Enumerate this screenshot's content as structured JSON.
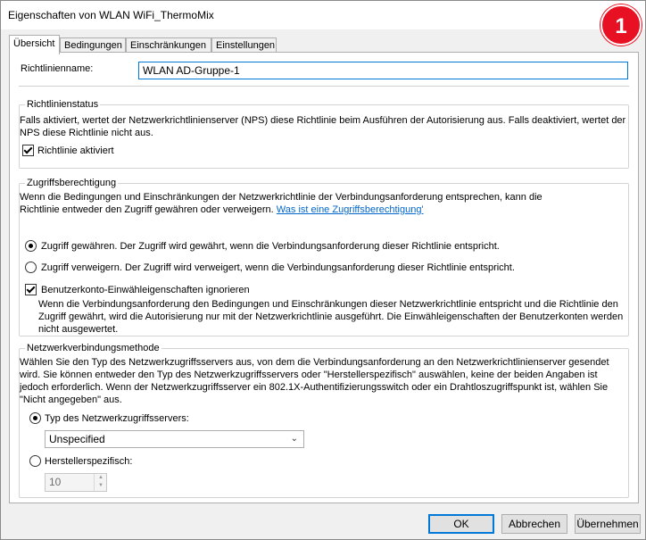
{
  "window": {
    "title": "Eigenschaften von WLAN WiFi_ThermoMix",
    "step_badge": "1"
  },
  "tabs": [
    {
      "label": "Übersicht",
      "active": true
    },
    {
      "label": "Bedingungen",
      "active": false
    },
    {
      "label": "Einschränkungen",
      "active": false
    },
    {
      "label": "Einstellungen",
      "active": false
    }
  ],
  "policy_name": {
    "label": "Richtlinienname:",
    "value": "WLAN AD-Gruppe-1"
  },
  "policy_status": {
    "title": "Richtlinienstatus",
    "description_1": "Falls aktiviert, wertet der Netzwerkrichtlinienserver (NPS) diese Richtlinie beim Ausführen der Autorisierung aus. Falls deaktiviert, wertet der",
    "description_2": "NPS diese Richtlinie nicht aus.",
    "enabled_label": "Richtlinie aktiviert",
    "enabled": true
  },
  "access_permission": {
    "title": "Zugriffsberechtigung",
    "description_1": "Wenn die Bedingungen und Einschränkungen der Netzwerkrichtlinie der Verbindungsanforderung entsprechen, kann die",
    "description_2": "Richtlinie entweder den Zugriff gewähren oder verweigern.",
    "help_link": "Was ist eine Zugriffsberechtigung'",
    "grant_label": "Zugriff gewähren. Der Zugriff wird gewährt, wenn die Verbindungsanforderung dieser Richtlinie entspricht.",
    "deny_label": "Zugriff verweigern. Der Zugriff wird verweigert, wenn die Verbindungsanforderung dieser Richtlinie entspricht.",
    "selected": "grant",
    "ignore_dialin_label": "Benutzerkonto-Einwähleigenschaften ignorieren",
    "ignore_dialin_checked": true,
    "ignore_desc_1": "Wenn die Verbindungsanforderung den Bedingungen und Einschränkungen dieser Netzwerkrichtlinie entspricht und die Richtlinie den",
    "ignore_desc_2": "Zugriff gewährt, wird die Autorisierung nur mit der Netzwerkrichtlinie ausgeführt. Die Einwähleigenschaften der Benutzerkonten werden",
    "ignore_desc_3": "nicht ausgewertet."
  },
  "connection_method": {
    "title": "Netzwerkverbindungsmethode",
    "desc_1": "Wählen Sie den Typ des Netzwerkzugriffsservers aus, von dem die Verbindungsanforderung an den Netzwerkrichtlinienserver gesendet",
    "desc_2": "wird. Sie können entweder den Typ des Netzwerkzugriffsservers oder \"Herstellerspezifisch\" auswählen, keine der beiden Angaben ist",
    "desc_3": "jedoch erforderlich. Wenn der Netzwerkzugriffsserver ein 802.1X-Authentifizierungsswitch oder ein Drahtloszugriffspunkt ist, wählen Sie",
    "desc_4": "\"Nicht angegeben\" aus.",
    "type_label": "Typ des Netzwerkzugriffsservers:",
    "type_value": "Unspecified",
    "vendor_label": "Herstellerspezifisch:",
    "vendor_value": "10",
    "selected": "type"
  },
  "buttons": {
    "ok": "OK",
    "cancel": "Abbrechen",
    "apply": "Übernehmen"
  },
  "colors": {
    "accent": "#0078d7",
    "badge": "#e81123",
    "link": "#0066cc"
  }
}
